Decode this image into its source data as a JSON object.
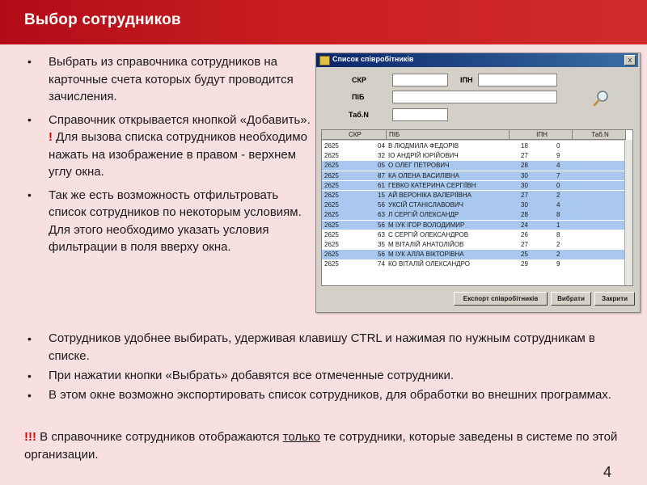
{
  "header": {
    "title": "Выбор сотрудников"
  },
  "bullets": [
    {
      "text": "Выбрать из справочника сотрудников на карточные счета которых будут проводится зачисления."
    },
    {
      "text": "Справочник открывается кнопкой «Добавить».",
      "extra_mark": "!",
      "extra_text": " Для вызова списка сотрудников необходимо нажать на изображение в правом - верхнем углу окна."
    },
    {
      "text": "Так же есть возможность отфильтровать список сотрудников по некоторым условиям. Для этого необходимо указать условия фильтрации в поля вверху окна."
    }
  ],
  "bottom_bullets": [
    "Сотрудников удобнее выбирать, удерживая клавишу CTRL и нажимая по нужным сотрудникам в списке.",
    "При нажатии кнопки «Выбрать» добавятся все отмеченные сотрудники.",
    "В этом окне возможно экспортировать список сотрудников, для обработки во внешних программах."
  ],
  "note": {
    "mark": "!!!",
    "part1": " В справочнике сотрудников отображаются ",
    "underlined": "только",
    "part2": " те сотрудники, которые заведены в системе по этой организации."
  },
  "page_number": "4",
  "dialog": {
    "title": "Список співробітників",
    "close": "x",
    "labels": {
      "skr": "СКР",
      "ipn": "ІПН",
      "pib": "ПІБ",
      "tab": "Таб.N"
    },
    "columns": [
      "СКР",
      "ПІБ",
      "ІПН",
      "Таб.N"
    ],
    "rows": [
      {
        "c1": "2625",
        "c2": "04",
        "c3": "В ЛЮДМИЛА ФЕДОРІВ",
        "c4": "18",
        "c5": "0",
        "sel": false
      },
      {
        "c1": "2625",
        "c2": "32",
        "c3": "ІО АНДРІЙ ЮРІЙОВИЧ",
        "c4": "27",
        "c5": "9",
        "sel": false
      },
      {
        "c1": "2625",
        "c2": "05",
        "c3": "О ОЛЕГ ПЕТРОВИЧ",
        "c4": "28",
        "c5": "4",
        "sel": true
      },
      {
        "c1": "2625",
        "c2": "87",
        "c3": "КА ОЛЕНА ВАСИЛІВНА",
        "c4": "30",
        "c5": "7",
        "sel": true
      },
      {
        "c1": "2625",
        "c2": "61",
        "c3": "ГЕВКО КАТЕРИНА СЕРГІЇВН",
        "c4": "30",
        "c5": "0",
        "sel": true
      },
      {
        "c1": "2625",
        "c2": "15",
        "c3": "АЙ ВЕРОНІКА ВАЛЕРІЇВНА",
        "c4": "27",
        "c5": "2",
        "sel": true
      },
      {
        "c1": "2625",
        "c2": "56",
        "c3": "УКСІЙ СТАНІСЛАВОВИЧ",
        "c4": "30",
        "c5": "4",
        "sel": true
      },
      {
        "c1": "2625",
        "c2": "63",
        "c3": "Л СЕРГІЙ ОЛЕКСАНДР",
        "c4": "28",
        "c5": "8",
        "sel": true
      },
      {
        "c1": "2625",
        "c2": "56",
        "c3": "М ІУК ІГОР ВОЛОДИМИР",
        "c4": "24",
        "c5": "1",
        "sel": true
      },
      {
        "c1": "2625",
        "c2": "63",
        "c3": "С СЕРГІЙ ОЛЕКСАНДРОВ",
        "c4": "26",
        "c5": "8",
        "sel": false
      },
      {
        "c1": "2625",
        "c2": "35",
        "c3": "М ВІТАЛІЙ АНАТОЛІЙОВ",
        "c4": "27",
        "c5": "2",
        "sel": false
      },
      {
        "c1": "2625",
        "c2": "56",
        "c3": "М ІУК АЛЛА ВІКТОРІВНА",
        "c4": "25",
        "c5": "2",
        "sel": true
      },
      {
        "c1": "2625",
        "c2": "74",
        "c3": "КО ВІТАЛІЙ ОЛЕКСАНДРО",
        "c4": "29",
        "c5": "9",
        "sel": false
      }
    ],
    "buttons": {
      "export": "Експорт співробітників",
      "select": "Вибрати",
      "close": "Закрити"
    }
  }
}
